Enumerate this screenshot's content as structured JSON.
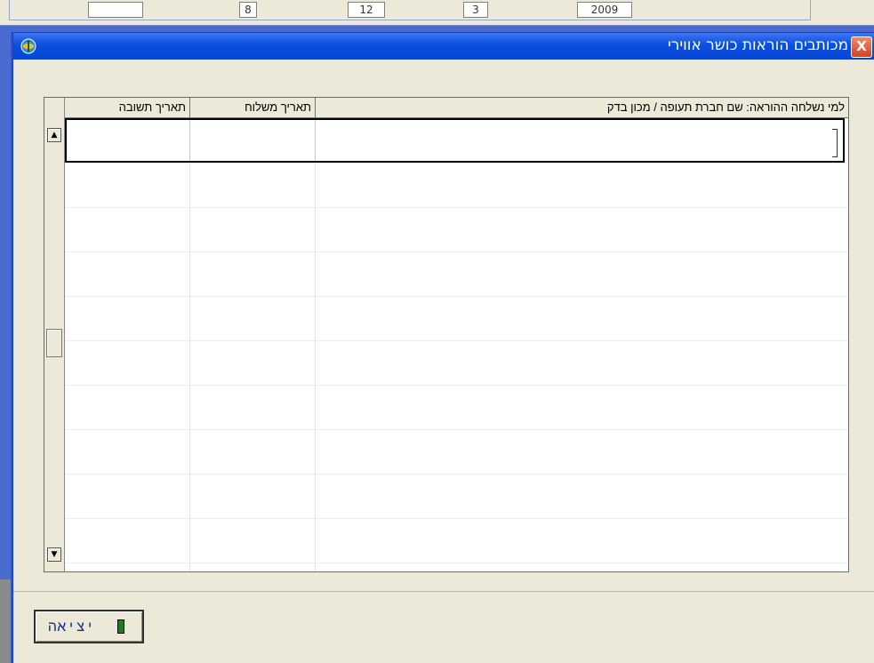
{
  "background": {
    "fields": [
      "2009",
      "3",
      "12",
      "8"
    ]
  },
  "dialog": {
    "title": "מכותבים הוראות כושר אווירי",
    "close_label": "X",
    "table": {
      "headers": {
        "recipient": "למי נשלחה ההוראה: שם חברת תעופה /   מכון בדק",
        "sent_date": "תאריך משלוח",
        "reply_date": "תאריך תשובה"
      }
    },
    "exit_button_label": "יציאה"
  },
  "colors": {
    "title_bar": "#0a4fe0",
    "dialog_bg": "#ece9d8",
    "close_button": "#d6401e"
  }
}
